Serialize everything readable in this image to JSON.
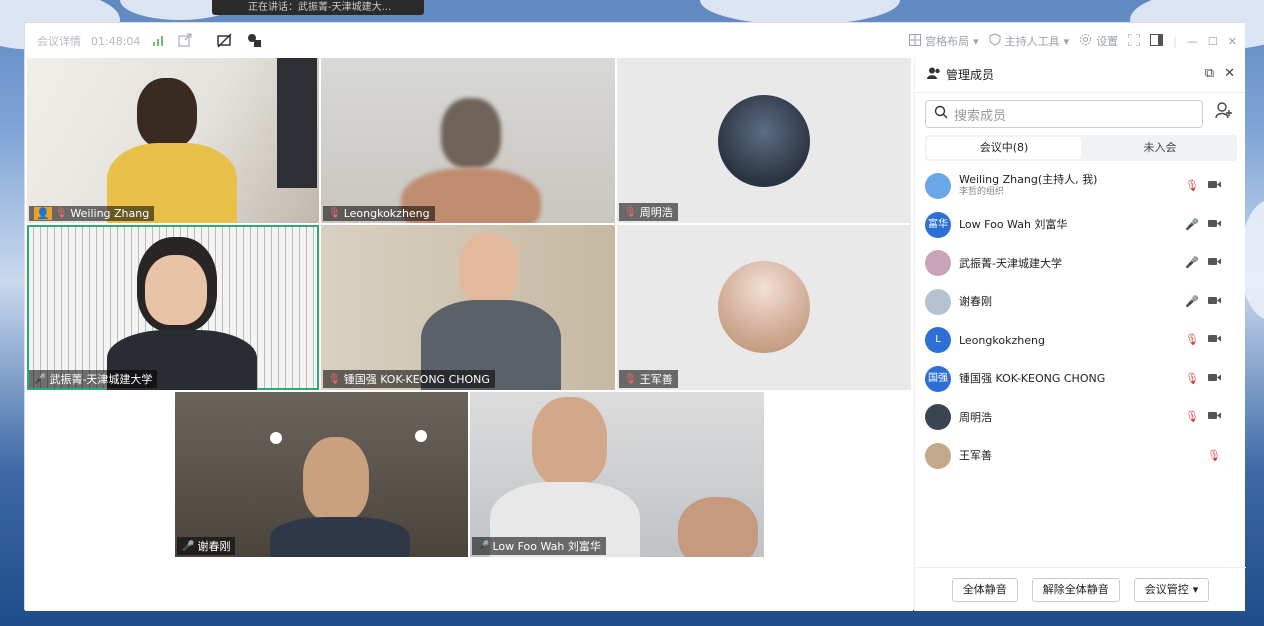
{
  "toast": {
    "text": "正在讲话：武振菁-天津城建大..."
  },
  "topbar": {
    "meeting_details": "会议详情",
    "timer": "01:48:04",
    "layout": "宫格布局",
    "host_tools": "主持人工具",
    "settings": "设置"
  },
  "tiles": [
    {
      "name": "Weiling Zhang"
    },
    {
      "name": "Leongkokzheng"
    },
    {
      "name": "周明浩"
    },
    {
      "name": "武振菁-天津城建大学"
    },
    {
      "name": "锺国强 KOK-KEONG CHONG"
    },
    {
      "name": "王军善"
    },
    {
      "name": "谢春刚"
    },
    {
      "name": "Low Foo Wah 刘富华"
    }
  ],
  "panel": {
    "title": "管理成员",
    "search_placeholder": "搜索成员",
    "tab_in": "会议中(8)",
    "tab_out": "未入会",
    "members": [
      {
        "name": "Weiling Zhang(主持人, 我)",
        "sub": "李哲的组织",
        "avatar_text": "",
        "color": "#6aa7e8",
        "mic_off": true
      },
      {
        "name": "Low Foo Wah 刘富华",
        "sub": "",
        "avatar_text": "富华",
        "color": "#2e6fd6",
        "mic_off": false
      },
      {
        "name": "武振菁-天津城建大学",
        "sub": "",
        "avatar_text": "",
        "color": "#c9a3b8",
        "mic_off": false
      },
      {
        "name": "谢春刚",
        "sub": "",
        "avatar_text": "",
        "color": "#b4c3cf",
        "mic_off": false
      },
      {
        "name": "Leongkokzheng",
        "sub": "",
        "avatar_text": "L",
        "color": "#2e6fd6",
        "mic_off": true
      },
      {
        "name": "锺国强 KOK-KEONG CHONG",
        "sub": "",
        "avatar_text": "国强",
        "color": "#2e6fd6",
        "mic_off": true
      },
      {
        "name": "周明浩",
        "sub": "",
        "avatar_text": "",
        "color": "#3a4552",
        "mic_off": true
      },
      {
        "name": "王军善",
        "sub": "",
        "avatar_text": "",
        "color": "#c2a98c",
        "mic_off": true
      }
    ],
    "mute_all": "全体静音",
    "unmute_all": "解除全体静音",
    "meeting_control": "会议管控"
  }
}
